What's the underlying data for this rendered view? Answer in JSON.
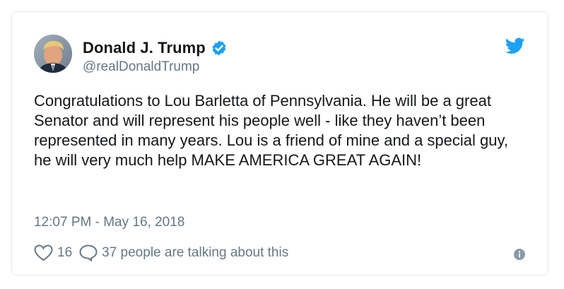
{
  "tweet": {
    "display_name": "Donald J. Trump",
    "handle": "@realDonaldTrump",
    "text": "Congratulations to Lou Barletta of Pennsylvania. He will be a great Senator and will represent his people well - like they haven’t been represented in many years. Lou is a friend of mine and a special guy, he will very much help MAKE AMERICA GREAT AGAIN!",
    "timestamp": "12:07 PM - May 16, 2018",
    "like_count": "16",
    "talking_text": "37 people are talking about this",
    "verified": true
  },
  "icons": {
    "avatar": "profile-photo",
    "verified": "verified-badge-icon",
    "brand": "twitter-bird-icon",
    "like": "heart-icon",
    "reply": "speech-bubble-icon",
    "info": "info-icon"
  },
  "colors": {
    "accent": "#1da1f2",
    "text": "#14171a",
    "secondary": "#657786",
    "border": "#e1e8ed"
  }
}
